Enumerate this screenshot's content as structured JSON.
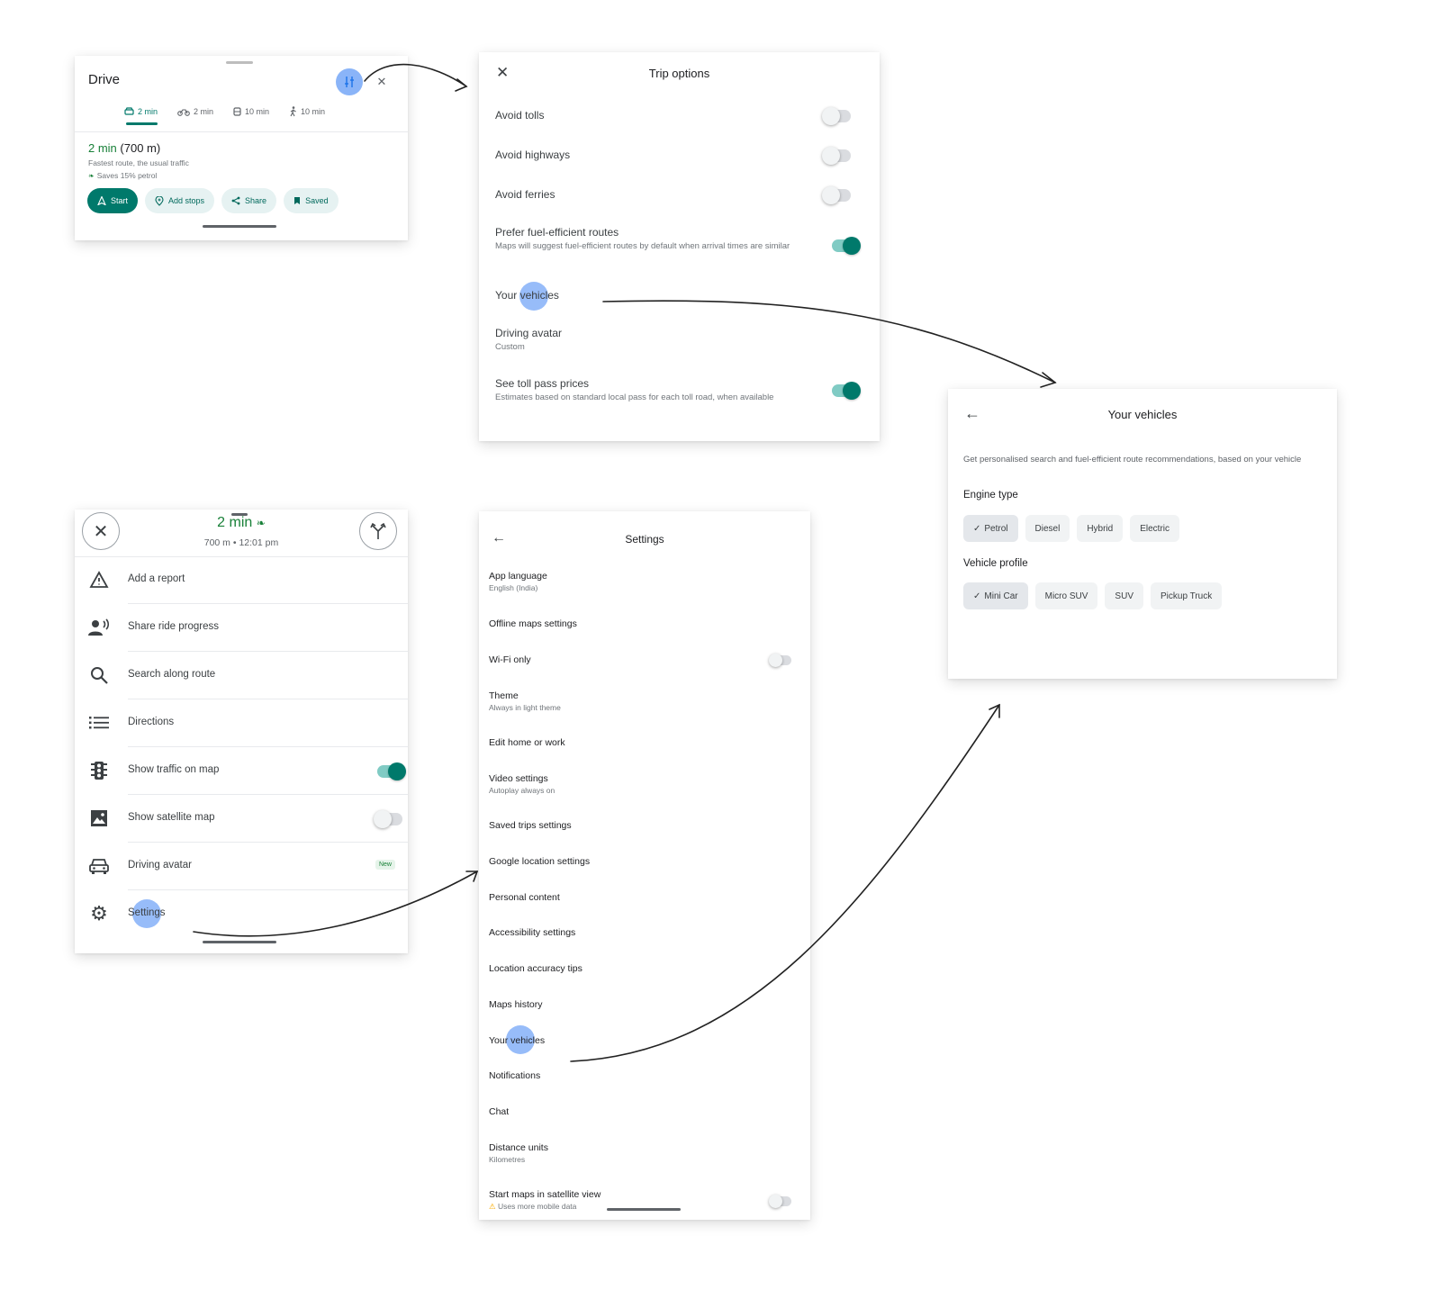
{
  "colors": {
    "accent": "#00796b",
    "eta_green": "#188038",
    "tap_highlight": "#4285f4"
  },
  "drive": {
    "title": "Drive",
    "modes": [
      {
        "icon": "car-icon",
        "label": "2 min",
        "active": true
      },
      {
        "icon": "motorbike-icon",
        "label": "2 min",
        "active": false
      },
      {
        "icon": "transit-icon",
        "label": "10 min",
        "active": false
      },
      {
        "icon": "walk-icon",
        "label": "10 min",
        "active": false
      }
    ],
    "route_time": "2 min",
    "route_distance": "(700 m)",
    "route_sub": "Fastest route, the usual traffic",
    "route_saves": "Saves 15% petrol",
    "chips": {
      "start": "Start",
      "add_stops": "Add stops",
      "share": "Share",
      "saved": "Saved"
    }
  },
  "trip": {
    "title": "Trip options",
    "avoid_tolls": {
      "label": "Avoid tolls",
      "on": false
    },
    "avoid_highways": {
      "label": "Avoid highways",
      "on": false
    },
    "avoid_ferries": {
      "label": "Avoid ferries",
      "on": false
    },
    "fuel": {
      "label": "Prefer fuel-efficient routes",
      "sub": "Maps will suggest fuel-efficient routes by default when arrival times are similar",
      "on": true
    },
    "vehicles": {
      "label": "Your vehicles"
    },
    "avatar": {
      "label": "Driving avatar",
      "sub": "Custom"
    },
    "toll_pass": {
      "label": "See toll pass prices",
      "sub": "Estimates based on standard local pass for each toll road, when available",
      "on": true
    }
  },
  "vehicles": {
    "title": "Your vehicles",
    "desc": "Get personalised search and fuel-efficient route recommendations, based on your vehicle",
    "engine_label": "Engine type",
    "engine": [
      "Petrol",
      "Diesel",
      "Hybrid",
      "Electric"
    ],
    "engine_selected": "Petrol",
    "profile_label": "Vehicle profile",
    "profile": [
      "Mini Car",
      "Micro SUV",
      "SUV",
      "Pickup Truck"
    ],
    "profile_selected": "Mini Car"
  },
  "nav": {
    "eta": "2 min",
    "eta_sub": "700 m  •  12:01 pm",
    "items": [
      {
        "icon": "report-warning-icon",
        "label": "Add a report"
      },
      {
        "icon": "share-ride-icon",
        "label": "Share ride progress"
      },
      {
        "icon": "search-icon",
        "label": "Search along route"
      },
      {
        "icon": "list-icon",
        "label": "Directions"
      },
      {
        "icon": "traffic-light-icon",
        "label": "Show traffic on map",
        "toggle": true
      },
      {
        "icon": "satellite-image-icon",
        "label": "Show satellite map",
        "toggle": false
      },
      {
        "icon": "car-front-icon",
        "label": "Driving avatar",
        "badge": "New"
      },
      {
        "icon": "gear-icon",
        "label": "Settings"
      }
    ]
  },
  "settings": {
    "title": "Settings",
    "items": [
      {
        "label": "App language",
        "sub": "English (India)"
      },
      {
        "label": "Offline maps settings"
      },
      {
        "label": "Wi-Fi only",
        "toggle": false
      },
      {
        "label": "Theme",
        "sub": "Always in light theme"
      },
      {
        "label": "Edit home or work"
      },
      {
        "label": "Video settings",
        "sub": "Autoplay always on"
      },
      {
        "label": "Saved trips settings"
      },
      {
        "label": "Google location settings"
      },
      {
        "label": "Personal content"
      },
      {
        "label": "Accessibility settings"
      },
      {
        "label": "Location accuracy tips"
      },
      {
        "label": "Maps history"
      },
      {
        "label": "Your vehicles"
      },
      {
        "label": "Notifications"
      },
      {
        "label": "Chat"
      },
      {
        "label": "Distance units",
        "sub": "Kilometres"
      },
      {
        "label": "Start maps in satellite view",
        "sub": "Uses more mobile data",
        "toggle": false
      }
    ]
  }
}
